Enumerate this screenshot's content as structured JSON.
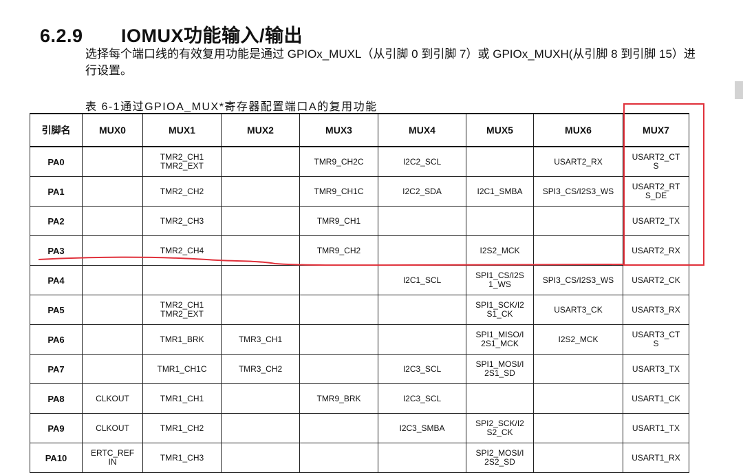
{
  "heading": {
    "number": "6.2.9",
    "title": "IOMUX功能输入/输出"
  },
  "intro": "选择每个端口线的有效复用功能是通过 GPIOx_MUXL（从引脚 0 到引脚 7）或 GPIOx_MUXH(从引脚 8 到引脚 15）进行设置。",
  "caption": "表  6-1通过GPIOA_MUX*寄存器配置端口A的复用功能",
  "table": {
    "headers": [
      "引脚名",
      "MUX0",
      "MUX1",
      "MUX2",
      "MUX3",
      "MUX4",
      "MUX5",
      "MUX6",
      "MUX7"
    ],
    "rows": [
      [
        "PA0",
        "",
        "TMR2_CH1\nTMR2_EXT",
        "",
        "TMR9_CH2C",
        "I2C2_SCL",
        "",
        "USART2_RX",
        "USART2_CT\nS"
      ],
      [
        "PA1",
        "",
        "TMR2_CH2",
        "",
        "TMR9_CH1C",
        "I2C2_SDA",
        "I2C1_SMBA",
        "SPI3_CS/I2S3_WS",
        "USART2_RT\nS_DE"
      ],
      [
        "PA2",
        "",
        "TMR2_CH3",
        "",
        "TMR9_CH1",
        "",
        "",
        "",
        "USART2_TX"
      ],
      [
        "PA3",
        "",
        "TMR2_CH4",
        "",
        "TMR9_CH2",
        "",
        "I2S2_MCK",
        "",
        "USART2_RX"
      ],
      [
        "PA4",
        "",
        "",
        "",
        "",
        "I2C1_SCL",
        "SPI1_CS/I2S\n1_WS",
        "SPI3_CS/I2S3_WS",
        "USART2_CK"
      ],
      [
        "PA5",
        "",
        "TMR2_CH1\nTMR2_EXT",
        "",
        "",
        "",
        "SPI1_SCK/I2\nS1_CK",
        "USART3_CK",
        "USART3_RX"
      ],
      [
        "PA6",
        "",
        "TMR1_BRK",
        "TMR3_CH1",
        "",
        "",
        "SPI1_MISO/I\n2S1_MCK",
        "I2S2_MCK",
        "USART3_CT\nS"
      ],
      [
        "PA7",
        "",
        "TMR1_CH1C",
        "TMR3_CH2",
        "",
        "I2C3_SCL",
        "SPI1_MOSI/I\n2S1_SD",
        "",
        "USART3_TX"
      ],
      [
        "PA8",
        "CLKOUT",
        "TMR1_CH1",
        "",
        "TMR9_BRK",
        "I2C3_SCL",
        "",
        "",
        "USART1_CK"
      ],
      [
        "PA9",
        "CLKOUT",
        "TMR1_CH2",
        "",
        "",
        "I2C3_SMBA",
        "SPI2_SCK/I2\nS2_CK",
        "",
        "USART1_TX"
      ],
      [
        "PA10",
        "ERTC_REF\nIN",
        "TMR1_CH3",
        "",
        "",
        "",
        "SPI2_MOSI/I\n2S2_SD",
        "",
        "USART1_RX"
      ]
    ]
  },
  "annotations": {
    "color": "#e0303a"
  }
}
